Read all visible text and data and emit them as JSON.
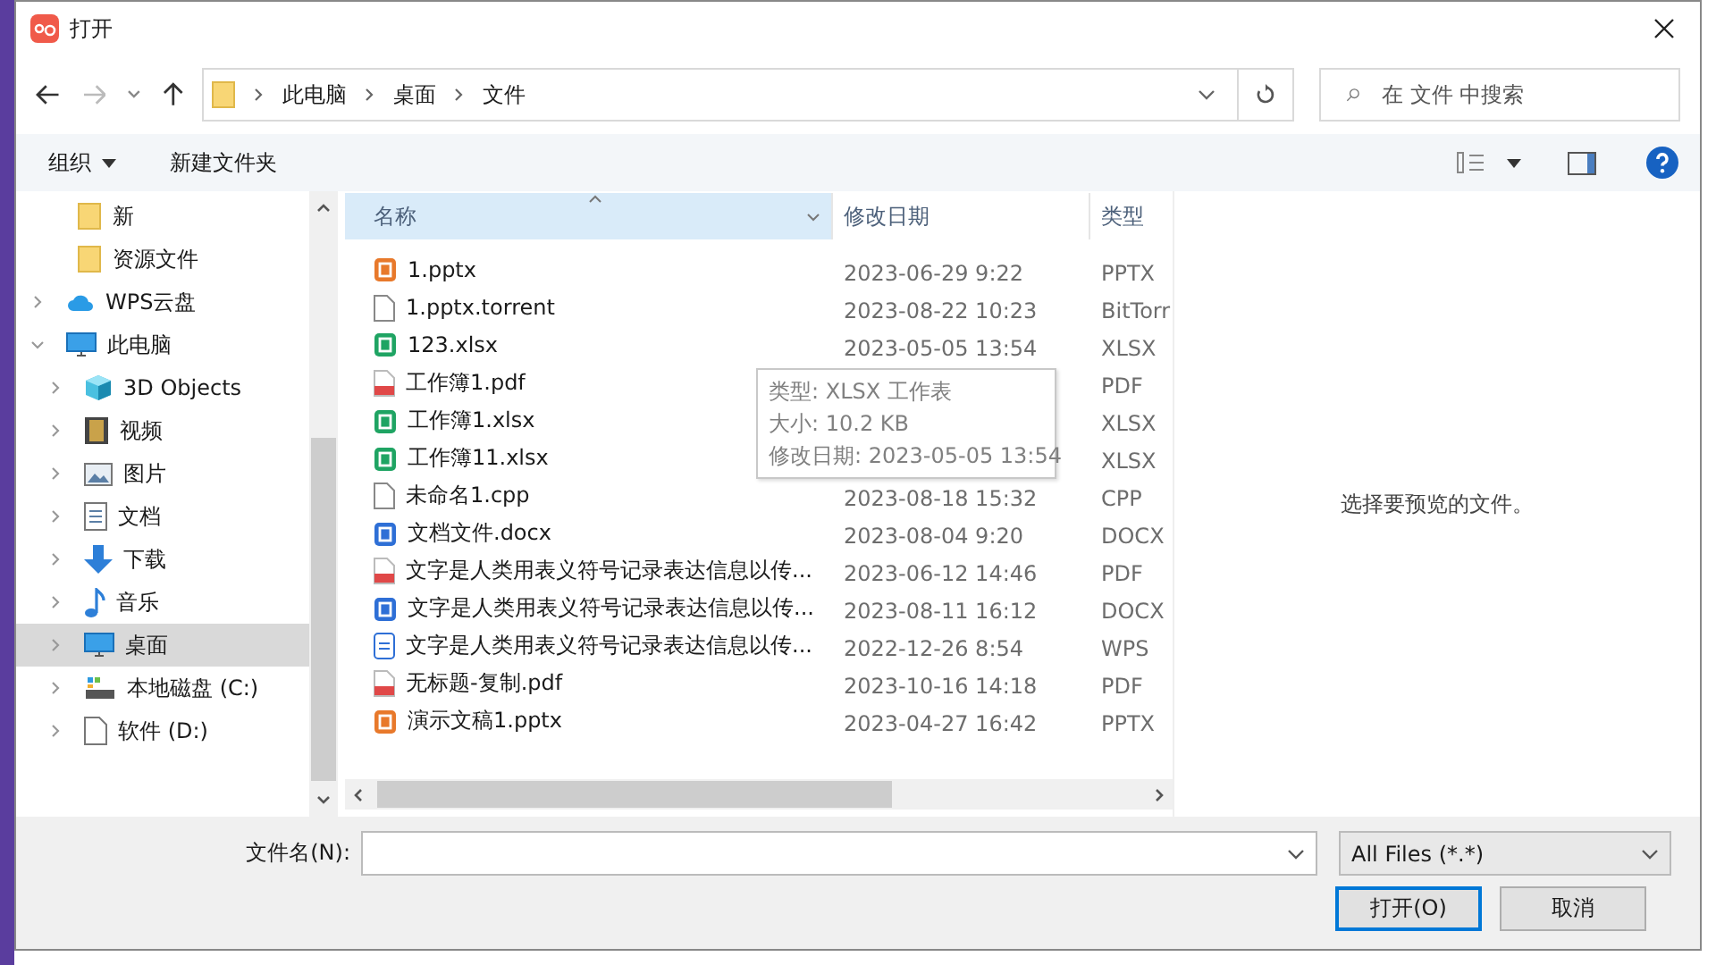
{
  "window": {
    "title": "打开"
  },
  "address": {
    "path": [
      "此电脑",
      "桌面",
      "文件"
    ]
  },
  "search": {
    "placeholder": "在 文件 中搜索"
  },
  "toolbar": {
    "organize": "组织",
    "new_folder": "新建文件夹"
  },
  "sidebar": {
    "items": [
      {
        "kind": "folder",
        "label": "新",
        "selected": false
      },
      {
        "kind": "folder",
        "label": "资源文件",
        "selected": false
      },
      {
        "kind": "cloud",
        "label": "WPS云盘",
        "expanded": false,
        "selected": false
      },
      {
        "kind": "pc",
        "label": "此电脑",
        "expanded": true,
        "selected": false,
        "children": [
          {
            "kind": "cube",
            "label": "3D Objects",
            "expanded": false,
            "selected": false
          },
          {
            "kind": "video",
            "label": "视频",
            "expanded": false,
            "selected": false
          },
          {
            "kind": "pictures",
            "label": "图片",
            "expanded": false,
            "selected": false
          },
          {
            "kind": "documents",
            "label": "文档",
            "expanded": false,
            "selected": false
          },
          {
            "kind": "downloads",
            "label": "下载",
            "expanded": false,
            "selected": false
          },
          {
            "kind": "music",
            "label": "音乐",
            "expanded": false,
            "selected": false
          },
          {
            "kind": "desktop",
            "label": "桌面",
            "expanded": false,
            "selected": true
          },
          {
            "kind": "drive",
            "label": "本地磁盘 (C:)",
            "expanded": false,
            "selected": false
          },
          {
            "kind": "disk",
            "label": "软件 (D:)",
            "expanded": false,
            "selected": false
          }
        ]
      }
    ]
  },
  "table": {
    "columns": [
      {
        "label": "名称",
        "sorted": true
      },
      {
        "label": "修改日期",
        "sorted": false
      },
      {
        "label": "类型",
        "sorted": false
      }
    ],
    "rows": [
      {
        "kind": "pptx",
        "name": "1.pptx",
        "modified": "2023-06-29 9:22",
        "type": "PPTX"
      },
      {
        "kind": "blank",
        "name": "1.pptx.torrent",
        "modified": "2023-08-22 10:23",
        "type": "BitTorr"
      },
      {
        "kind": "xlsx",
        "name": "123.xlsx",
        "modified": "2023-05-05 13:54",
        "type": "XLSX"
      },
      {
        "kind": "pdf",
        "name": "工作簿1.pdf",
        "type": "PDF"
      },
      {
        "kind": "xlsx",
        "name": "工作簿1.xlsx",
        "type": "XLSX"
      },
      {
        "kind": "xlsx",
        "name": "工作簿11.xlsx",
        "type": "XLSX"
      },
      {
        "kind": "blank",
        "name": "未命名1.cpp",
        "modified": "2023-08-18 15:32",
        "type": "CPP"
      },
      {
        "kind": "docx",
        "name": "文档文件.docx",
        "modified": "2023-08-04 9:20",
        "type": "DOCX"
      },
      {
        "kind": "pdf",
        "name": "文字是人类用表义符号记录表达信息以传...",
        "modified": "2023-06-12 14:46",
        "type": "PDF"
      },
      {
        "kind": "docx",
        "name": "文字是人类用表义符号记录表达信息以传...",
        "modified": "2023-08-11 16:12",
        "type": "DOCX"
      },
      {
        "kind": "wps",
        "name": "文字是人类用表义符号记录表达信息以传...",
        "modified": "2022-12-26 8:54",
        "type": "WPS"
      },
      {
        "kind": "pdf",
        "name": "无标题-复制.pdf",
        "modified": "2023-10-16 14:18",
        "type": "PDF"
      },
      {
        "kind": "pptx",
        "name": "演示文稿1.pptx",
        "modified": "2023-04-27 16:42",
        "type": "PPTX"
      }
    ]
  },
  "tooltip": {
    "lines": [
      "类型: XLSX 工作表",
      "大小: 10.2 KB",
      "修改日期: 2023-05-05 13:54"
    ]
  },
  "preview": {
    "message": "选择要预览的文件。"
  },
  "footer": {
    "filename_label": "文件名(N):",
    "filter": "All Files (*.*)",
    "buttons": [
      {
        "label": "打开(O)",
        "default": true
      },
      {
        "label": "取消",
        "default": false
      }
    ]
  }
}
